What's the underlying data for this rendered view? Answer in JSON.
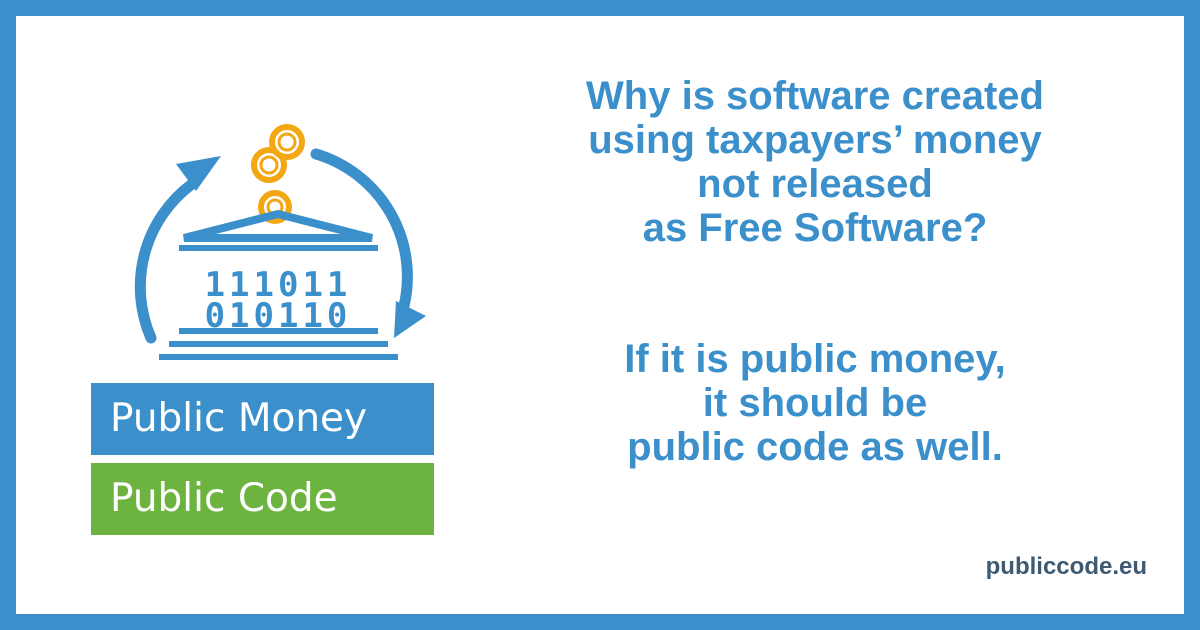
{
  "logo": {
    "binary_rows": [
      "111011",
      "010110"
    ],
    "banner_top": "Public Money",
    "banner_bottom": "Public Code"
  },
  "message": {
    "question_lines": [
      "Why is software created",
      "using taxpayers’ money",
      "not released",
      "as Free Software?"
    ],
    "answer_lines": [
      "If it is public money,",
      "it should be",
      "public code as well."
    ]
  },
  "footer": {
    "url": "publiccode.eu"
  },
  "colors": {
    "blue": "#3b8fcb",
    "green": "#6db33f",
    "coin": "#f3a712",
    "url_text": "#3d5a72"
  }
}
